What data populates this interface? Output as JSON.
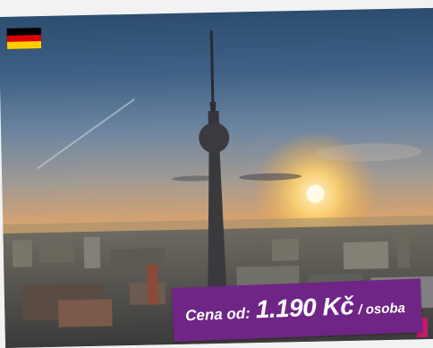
{
  "colors": {
    "badge_background": "#6f2586",
    "badge_accent": "#c01c6a",
    "badge_text": "#ffffff",
    "flag_black": "#000000",
    "flag_red": "#dd0000",
    "flag_gold": "#ffce00"
  },
  "offer": {
    "price_label": "Cena od:",
    "price_value": "1.190 Kč",
    "price_unit": "/ osoba"
  },
  "icons": {
    "flag": "germany-flag-icon"
  }
}
